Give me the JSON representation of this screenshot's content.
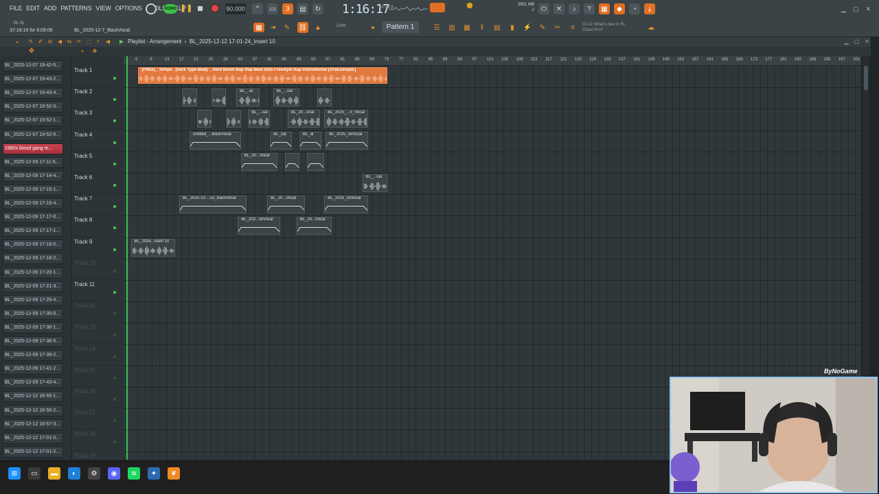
{
  "menu": [
    "FILE",
    "EDIT",
    "ADD",
    "PATTERNS",
    "VIEW",
    "OPTIONS",
    "TOOLS",
    "HELP"
  ],
  "transport": {
    "song_label": "SONG",
    "tempo": "90.000",
    "time": "1:16:17",
    "time_unit": "M:S:CS",
    "memory_line1": "3851 MB",
    "memory_line2": "2"
  },
  "status": {
    "hint_time": "37:16:16 for 6:09:06",
    "project": "BL_2025-12-7_BackVocal",
    "file": "BL.flp"
  },
  "toolbar": {
    "pattern": "Pattern 1",
    "snap": "Line",
    "news_line1": "03:12  What's new in FL",
    "news_line2": "Cloud Pro?"
  },
  "playlist": {
    "title": "Playlist - Arrangement",
    "breadcrumb": "BL_2025-12-12 17-01-24_Insert 10"
  },
  "browser": [
    "BL_2025-12-07 19-42-5...",
    "BL_2025-12-07 19-43-2...",
    "BL_2025-12-07 19-43-4...",
    "BL_2025-12-07 19-52-0...",
    "BL_2025-12-07 19-52-1...",
    "BL_2025-12-07 19-52-6...",
    "1980s blood gang m...",
    "BL_2025-12-09 17-11-5...",
    "BL_2025-12-09 17-14-4...",
    "BL_2025-12-09 17-15-1...",
    "BL_2025-12-09 17-16-4...",
    "BL_2025-12-09 17-17-0...",
    "BL_2025-12-09 17-17-1...",
    "BL_2025-12-09 17-18-0...",
    "BL_2025-12-09 17-18-2...",
    "BL_2025-12-09 17-20-1...",
    "BL_2025-12-09 17-21-3...",
    "BL_2025-12-09 17-29-4...",
    "BL_2025-12-09 17-30-0...",
    "BL_2025-12-09 17-36-1...",
    "BL_2025-12-09 17-38-5...",
    "BL_2025-12-09 17-39-2...",
    "BL_2025-12-09 17-41-2...",
    "BL_2025-12-09 17-43-4...",
    "BL_2025-12-12 16-55-1...",
    "BL_2025-12-12 16-56-2...",
    "BL_2025-12-12 16-57-3...",
    "BL_2025-12-12 17-01-0...",
    "BL_2025-12-12 17-01-2..."
  ],
  "tracks": [
    {
      "name": "Track 1",
      "active": true
    },
    {
      "name": "Track 2",
      "active": true
    },
    {
      "name": "Track 3",
      "active": true
    },
    {
      "name": "Track 4",
      "active": true
    },
    {
      "name": "Track 5",
      "active": true
    },
    {
      "name": "Track 6",
      "active": true
    },
    {
      "name": "Track 7",
      "active": true
    },
    {
      "name": "Track 8",
      "active": true
    },
    {
      "name": "Track 9",
      "active": true
    },
    {
      "name": "Track 10",
      "active": false
    },
    {
      "name": "Track 11",
      "active": true
    },
    {
      "name": "Track 12",
      "active": false
    },
    {
      "name": "Track 13",
      "active": false
    },
    {
      "name": "Track 14",
      "active": false
    },
    {
      "name": "Track 15",
      "active": false
    },
    {
      "name": "Track 16",
      "active": false
    },
    {
      "name": "Track 17",
      "active": false
    },
    {
      "name": "Track 18",
      "active": false
    },
    {
      "name": "Track 19",
      "active": false
    }
  ],
  "ruler": [
    5,
    9,
    13,
    17,
    21,
    25,
    29,
    33,
    37,
    41,
    45,
    49,
    53,
    57,
    61,
    65,
    69,
    73,
    77,
    81,
    85,
    89,
    93,
    97,
    101,
    105,
    109,
    113,
    117,
    121,
    125,
    129,
    133,
    137,
    141,
    145,
    149,
    153,
    157,
    161,
    165,
    169,
    173,
    177,
    181,
    185,
    189,
    193,
    197,
    201
  ],
  "clips": [
    {
      "track": 1,
      "start": 1,
      "end": 18,
      "label": "[FREE] _Tempo_ (Dark Type Beat) _ Hard Boom Bap Rap Beat 2025 Freestyle Rap Instrumental [AYaEa3uqoE]",
      "main": true
    },
    {
      "track": 2,
      "start": 4,
      "end": 5,
      "label": ""
    },
    {
      "track": 2,
      "start": 6,
      "end": 7,
      "label": ""
    },
    {
      "track": 2,
      "start": 7.7,
      "end": 9.3,
      "label": "BL_..al"
    },
    {
      "track": 2,
      "start": 10.2,
      "end": 12,
      "label": "BL_...cal"
    },
    {
      "track": 2,
      "start": 13.2,
      "end": 14.2,
      "label": ""
    },
    {
      "track": 3,
      "start": 5,
      "end": 6,
      "label": ""
    },
    {
      "track": 3,
      "start": 7,
      "end": 8,
      "label": ""
    },
    {
      "track": 3,
      "start": 8.5,
      "end": 10,
      "label": "BL_...cal"
    },
    {
      "track": 3,
      "start": 11.2,
      "end": 13.4,
      "label": "BL_20...ocal"
    },
    {
      "track": 3,
      "start": 13.7,
      "end": 16.7,
      "label": "BL_2025_...5_Vocal"
    },
    {
      "track": 4,
      "start": 4.5,
      "end": 8,
      "label": "untitled_...BackVocal",
      "flat": true
    },
    {
      "track": 4,
      "start": 10,
      "end": 11.5,
      "label": "BL_cal",
      "flat": true
    },
    {
      "track": 4,
      "start": 12,
      "end": 13.5,
      "label": "BL_al",
      "flat": true
    },
    {
      "track": 4,
      "start": 13.8,
      "end": 16.7,
      "label": "BL_2025_ckVocal",
      "flat": true
    },
    {
      "track": 5,
      "start": 8,
      "end": 10.5,
      "label": "BL_20...Vocal",
      "flat": true
    },
    {
      "track": 5,
      "start": 11,
      "end": 12,
      "label": "",
      "flat": true
    },
    {
      "track": 5,
      "start": 12.5,
      "end": 13.7,
      "label": "",
      "flat": true
    },
    {
      "track": 6,
      "start": 16.3,
      "end": 18,
      "label": "BL_...cal"
    },
    {
      "track": 7,
      "start": 3.8,
      "end": 8.4,
      "label": "BL_2025-12-...53_BackVocal",
      "flat": true
    },
    {
      "track": 7,
      "start": 9.8,
      "end": 12.4,
      "label": "BL_20...Vocal",
      "flat": true
    },
    {
      "track": 7,
      "start": 13.7,
      "end": 16.7,
      "label": "BL_2025_ckVocal",
      "flat": true
    },
    {
      "track": 8,
      "start": 7.8,
      "end": 10.7,
      "label": "BL_202...ckVocal",
      "flat": true
    },
    {
      "track": 8,
      "start": 11.8,
      "end": 14.2,
      "label": "BL_20...Vocal",
      "flat": true
    },
    {
      "track": 9,
      "start": 0.5,
      "end": 3.5,
      "label": "BL_2025...nsert 10"
    }
  ],
  "taskbar": [
    "windows-start",
    "task-view",
    "file-explorer",
    "edge",
    "settings",
    "discord",
    "spotify",
    "fl-studio",
    "fl-orange"
  ],
  "overlay": {
    "brand": "ByNoGame"
  },
  "colors": {
    "accent": "#e3793f",
    "playhead": "#30c45a",
    "selected": "#c84450"
  }
}
